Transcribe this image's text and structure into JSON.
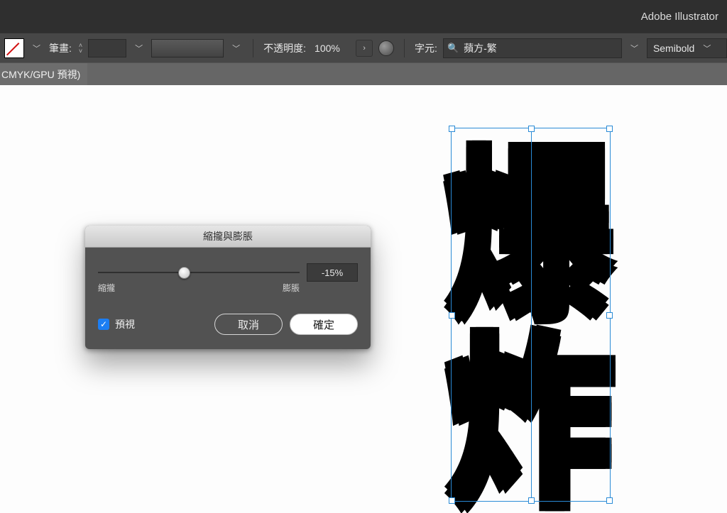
{
  "app": {
    "title": "Adobe Illustrator"
  },
  "controlbar": {
    "stroke_label": "筆畫:",
    "opacity_label": "不透明度:",
    "opacity_value": "100%",
    "character_label": "字元:",
    "font_name": "蘋方-繁",
    "font_weight": "Semibold"
  },
  "doc_tab": {
    "label": "CMYK/GPU 預視)"
  },
  "dialog": {
    "title": "縮攏與膨脹",
    "min_label": "縮攏",
    "max_label": "膨脹",
    "value": "-15%",
    "slider_min": -100,
    "slider_max": 100,
    "slider_value": -15,
    "preview_label": "預視",
    "preview_checked": true,
    "cancel_label": "取消",
    "ok_label": "確定"
  },
  "artwork": {
    "glyph1": "爆",
    "glyph2": "炸"
  },
  "colors": {
    "selection": "#2a8bd6"
  }
}
